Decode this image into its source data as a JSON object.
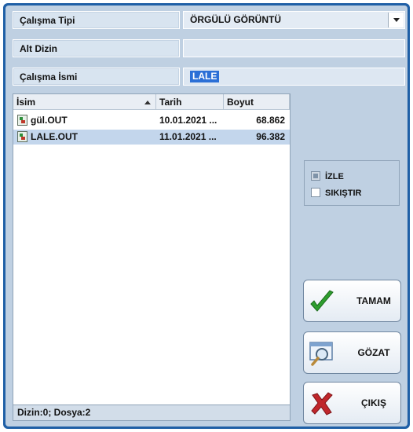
{
  "fields": {
    "work_type_label": "Çalışma Tipi",
    "work_type_value": "ÖRGÜLÜ GÖRÜNTÜ",
    "subdir_label": "Alt Dizin",
    "subdir_value": "",
    "work_name_label": "Çalışma İsmi",
    "work_name_value": "LALE"
  },
  "file_list": {
    "columns": [
      "İsim",
      "Tarih",
      "Boyut"
    ],
    "rows": [
      {
        "name": "gül.OUT",
        "date": "10.01.2021 ...",
        "size": "68.862",
        "selected": false
      },
      {
        "name": "LALE.OUT",
        "date": "11.01.2021 ...",
        "size": "96.382",
        "selected": true
      }
    ]
  },
  "status": "Dizin:0; Dosya:2",
  "options": {
    "watch_label": "İZLE",
    "watch_checked": true,
    "compress_label": "SIKIŞTIR",
    "compress_checked": false
  },
  "buttons": {
    "ok_label": "TAMAM",
    "browse_label": "GÖZAT",
    "exit_label": "ÇIKIŞ"
  },
  "colors": {
    "frame": "#1f5fa6",
    "panel": "#bfd0e2",
    "selection": "#2b6fd6",
    "ok_icon": "#2e9e2e",
    "exit_icon": "#c0262b"
  },
  "icons": {
    "combo": "chevron-down-icon",
    "sort": "sort-ascending-icon",
    "file": "out-file-icon",
    "ok": "checkmark-icon",
    "browse": "magnifier-window-icon",
    "exit": "red-x-icon"
  }
}
